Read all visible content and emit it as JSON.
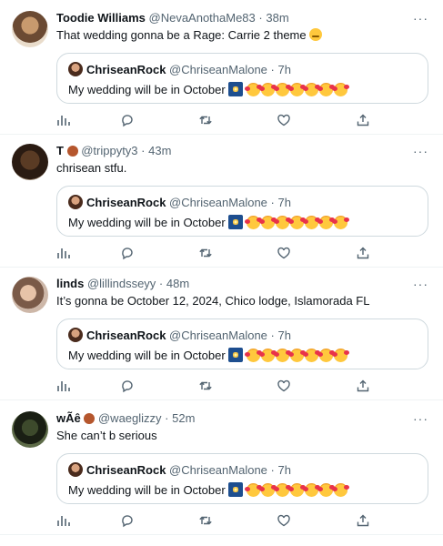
{
  "quoted": {
    "name": "ChriseanRock",
    "handle": "@ChriseanMalone",
    "dot": "·",
    "time": "7h",
    "text": "My wedding will be in October"
  },
  "icons": [
    "analytics-icon",
    "reply-icon",
    "retweet-icon",
    "like-icon",
    "share-icon",
    "more-options-icon",
    "fireworks-emoji",
    "hearts-face-emoji",
    "teddy-bear-emoji",
    "relieved-face-emoji"
  ],
  "tweets": [
    {
      "name": "Toodie Williams",
      "handle": "@NevaAnothaMe83",
      "dot": "·",
      "time": "38m",
      "text": "That wedding gonna be a Rage: Carrie 2 theme",
      "more": "···"
    },
    {
      "name": "T",
      "handle": "@trippyty3",
      "dot": "·",
      "time": "43m",
      "text": "chrisean stfu.",
      "more": "···"
    },
    {
      "name": "linds",
      "handle": "@lillindsseyy",
      "dot": "·",
      "time": "48m",
      "text": "It’s gonna be October 12, 2024, Chico lodge, Islamorada FL",
      "more": "···"
    },
    {
      "name": "wÃê",
      "handle": "@waeglizzy",
      "dot": "·",
      "time": "52m",
      "text": "She can’t b serious",
      "more": "···"
    }
  ]
}
